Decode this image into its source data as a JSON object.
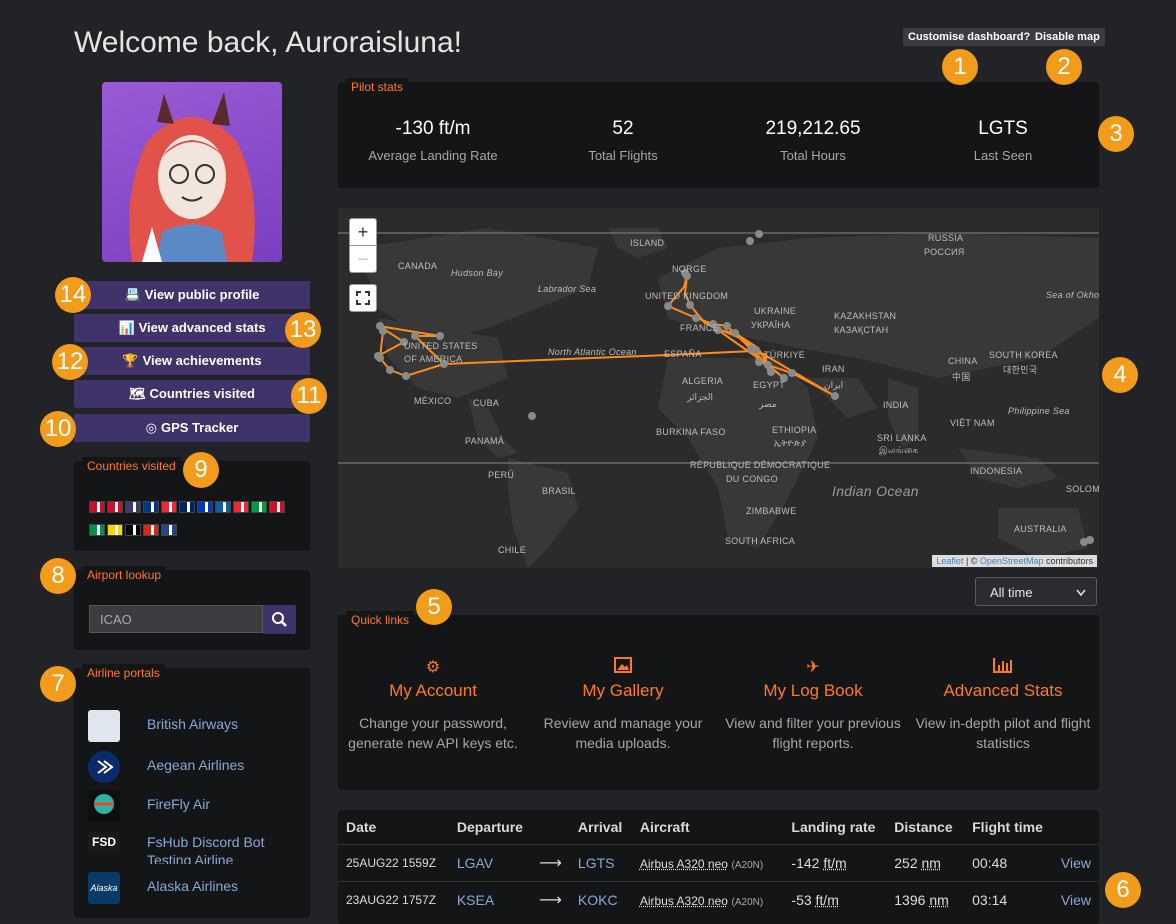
{
  "header": {
    "welcome": "Welcome back, Auroraisluna!",
    "customise_label": "Customise dashboard?",
    "disable_map_label": "Disable map"
  },
  "badges": [
    "1",
    "2",
    "3",
    "4",
    "5",
    "6",
    "7",
    "8",
    "9",
    "10",
    "11",
    "12",
    "13",
    "14"
  ],
  "pilot_stats": {
    "title": "Pilot stats",
    "items": [
      {
        "value": "-130 ft/m",
        "label": "Average Landing Rate"
      },
      {
        "value": "52",
        "label": "Total Flights"
      },
      {
        "value": "219,212.65",
        "label": "Total Hours"
      },
      {
        "value": "LGTS",
        "label": "Last Seen"
      }
    ]
  },
  "sidebar": {
    "buttons": [
      {
        "label": "View public profile",
        "icon": "id-card-icon"
      },
      {
        "label": "View advanced stats",
        "icon": "bar-chart-icon"
      },
      {
        "label": "View achievements",
        "icon": "trophy-icon"
      },
      {
        "label": "Countries visited",
        "icon": "map-icon"
      },
      {
        "label": "GPS Tracker",
        "icon": "target-icon"
      }
    ],
    "countries_title": "Countries visited",
    "flag_colors": [
      "#c8102e",
      "#ce1126",
      "#3c3b6e",
      "#003580",
      "#ed2939",
      "#012169",
      "#0038b8",
      "#0d5eaf",
      "#ed2939",
      "#009a44",
      "#ce1126",
      "#009246",
      "#fcd116",
      "#000000",
      "#d52b1e",
      "#21468b"
    ],
    "airport_title": "Airport lookup",
    "airport_placeholder": "ICAO",
    "airline_title": "Airline portals",
    "airlines": [
      {
        "name": "British Airways",
        "color": "#dfe6ee"
      },
      {
        "name": "Aegean Airlines",
        "color": "#0b2a6b"
      },
      {
        "name": "FireFly Air",
        "color": "#0f0f0f"
      },
      {
        "name": "FsHub Discord Bot",
        "logo_text": "FSD",
        "color": "#1a1a1a"
      },
      {
        "name": "Testing Airline",
        "color": "#1a1a1a"
      },
      {
        "name": "Alaska Airlines",
        "color": "#0a3a66"
      }
    ]
  },
  "map": {
    "zoom_in": "+",
    "zoom_out": "−",
    "labels": [
      "ISLAND",
      "RUSSIA",
      "РОССИЯ",
      "CANADA",
      "Hudson Bay",
      "NORGE",
      "Labrador Sea",
      "UNITED KINGDOM",
      "UKRAINE",
      "Sea of Okhot",
      "FRANCE",
      "УКРАЇНА",
      "KAZAKHSTAN",
      "КАЗАҚСТАН",
      "UNITED STATES",
      "OF AMERICA",
      "North Atlantic Ocean",
      "ESPAÑA",
      "TÜRKIYE",
      "CHINA",
      "中国",
      "SOUTH KOREA",
      "대한민국",
      "IRAN",
      "ایران",
      "ALGERIA",
      "الجزائر",
      "EGYPT",
      "مصر",
      "MÉXICO",
      "CUBA",
      "INDIA",
      "Philippine Sea",
      "BURKINA FASO",
      "ETHIOPIA",
      "ኢትዮጵያ",
      "SRI LANKA",
      "இலங்கை",
      "VIỆT NAM",
      "PANAMÁ",
      "RÉPUBLIQUE DÉMOCRATIQUE",
      "DU CONGO",
      "INDONESIA",
      "PERÚ",
      "BRASIL",
      "Indian Ocean",
      "ZIMBABWE",
      "SOUTH AFRICA",
      "CHILE",
      "AUSTRALIA",
      "SOLOM"
    ],
    "attribution_leaflet": "Leaflet",
    "attribution_sep": " | © ",
    "attribution_osm": "OpenStreetMap",
    "attribution_tail": " contributors"
  },
  "period_select": "All time",
  "quick_links": {
    "title": "Quick links",
    "items": [
      {
        "title": "My Account",
        "desc": "Change your password, generate new API keys etc.",
        "icon": "gears-icon"
      },
      {
        "title": "My Gallery",
        "desc": "Review and manage your media uploads.",
        "icon": "image-icon"
      },
      {
        "title": "My Log Book",
        "desc": "View and filter your previous flight reports.",
        "icon": "plane-icon"
      },
      {
        "title": "Advanced Stats",
        "desc": "View in-depth pilot and flight statistics",
        "icon": "bar-chart-icon"
      }
    ]
  },
  "flights": {
    "headers": [
      "Date",
      "Departure",
      "",
      "Arrival",
      "Aircraft",
      "Landing rate",
      "Distance",
      "Flight time",
      ""
    ],
    "rows": [
      {
        "date": "25AUG22 1559Z",
        "dep": "LGAV",
        "arr": "LGTS",
        "aircraft": "Airbus A320 neo",
        "code": "(A20N)",
        "rate": "-142",
        "rate_unit": "ft/m",
        "dist": "252",
        "dist_unit": "nm",
        "time": "00:48",
        "view": "View"
      },
      {
        "date": "23AUG22 1757Z",
        "dep": "KSEA",
        "arr": "KOKC",
        "aircraft": "Airbus A320 neo",
        "code": "(A20N)",
        "rate": "-53",
        "rate_unit": "ft/m",
        "dist": "1396",
        "dist_unit": "nm",
        "time": "03:14",
        "view": "View"
      }
    ]
  }
}
